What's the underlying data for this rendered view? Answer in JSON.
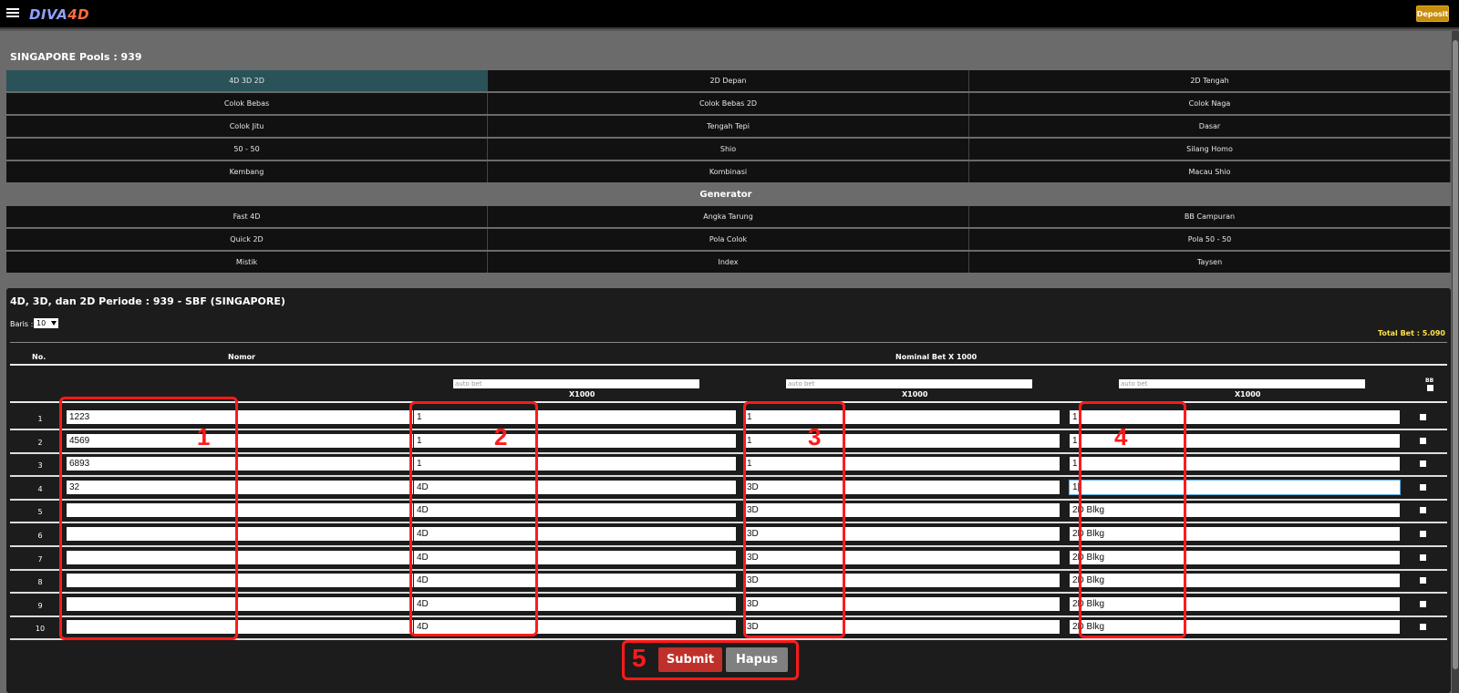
{
  "app": {
    "logo_main": "DIVA",
    "logo_accent": "4D"
  },
  "header": {
    "deposit_label": "Deposit"
  },
  "pool": {
    "title": "SINGAPORE Pools : 939"
  },
  "bet_types": [
    "4D 3D 2D",
    "2D Depan",
    "2D Tengah",
    "Colok Bebas",
    "Colok Bebas 2D",
    "Colok Naga",
    "Colok Jitu",
    "Tengah Tepi",
    "Dasar",
    "50 - 50",
    "Shio",
    "Silang Homo",
    "Kembang",
    "Kombinasi",
    "Macau Shio"
  ],
  "generator": {
    "label": "Generator",
    "items": [
      "Fast 4D",
      "Angka Tarung",
      "BB Campuran",
      "Quick 2D",
      "Pola Colok",
      "Pola 50 - 50",
      "Mistik",
      "Index",
      "Taysen"
    ]
  },
  "form": {
    "title": "4D, 3D, dan 2D Periode : 939 - SBF (SINGAPORE)",
    "baris_label": "Baris :",
    "baris_value": "10",
    "total_bet": "Total Bet : 5.090",
    "col_no": "No.",
    "col_nomor": "Nomor",
    "col_nominal": "Nominal Bet X 1000",
    "autobet_placeholder": "auto bet",
    "x1000": "X1000",
    "bb_label": "BB",
    "rows": [
      {
        "no": "1",
        "nomor": "1223",
        "b4d": "1",
        "b3d": "1",
        "b2d": "1"
      },
      {
        "no": "2",
        "nomor": "4569",
        "b4d": "1",
        "b3d": "1",
        "b2d": "1"
      },
      {
        "no": "3",
        "nomor": "6893",
        "b4d": "1",
        "b3d": "1",
        "b2d": "1"
      },
      {
        "no": "4",
        "nomor": "32",
        "b4d": "4D",
        "b3d": "3D",
        "b2d": "1|"
      },
      {
        "no": "5",
        "nomor": "",
        "b4d": "4D",
        "b3d": "3D",
        "b2d": "2D Blkg"
      },
      {
        "no": "6",
        "nomor": "",
        "b4d": "4D",
        "b3d": "3D",
        "b2d": "2D Blkg"
      },
      {
        "no": "7",
        "nomor": "",
        "b4d": "4D",
        "b3d": "3D",
        "b2d": "2D Blkg"
      },
      {
        "no": "8",
        "nomor": "",
        "b4d": "4D",
        "b3d": "3D",
        "b2d": "2D Blkg"
      },
      {
        "no": "9",
        "nomor": "",
        "b4d": "4D",
        "b3d": "3D",
        "b2d": "2D Blkg"
      },
      {
        "no": "10",
        "nomor": "",
        "b4d": "4D",
        "b3d": "3D",
        "b2d": "2D Blkg"
      }
    ],
    "submit_label": "Submit",
    "hapus_label": "Hapus"
  },
  "annotations": [
    "1",
    "2",
    "3",
    "4",
    "5"
  ]
}
